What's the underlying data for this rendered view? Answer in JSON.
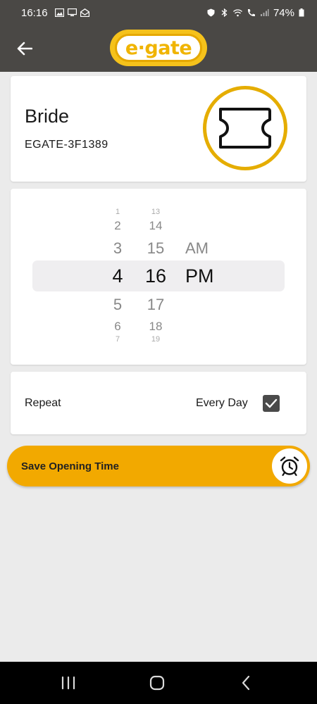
{
  "status_bar": {
    "time": "16:16",
    "battery": "74%"
  },
  "app": {
    "logo_text": "e·gate"
  },
  "device": {
    "name": "Bride",
    "id": "EGATE-3F1389"
  },
  "time_picker": {
    "hours": [
      "1",
      "2",
      "3",
      "4",
      "5",
      "6",
      "7"
    ],
    "minutes": [
      "13",
      "14",
      "15",
      "16",
      "17",
      "18",
      "19"
    ],
    "ampm": [
      "AM",
      "PM"
    ],
    "selected_hour": "4",
    "selected_minute": "16",
    "selected_ampm": "PM"
  },
  "repeat": {
    "label": "Repeat",
    "value": "Every Day",
    "checked": true
  },
  "save_button": {
    "label": "Save Opening Time"
  },
  "colors": {
    "accent": "#f2a900",
    "header": "#4a4845",
    "ring": "#e5ad00"
  },
  "icons": [
    "back-arrow-icon",
    "ticket-icon",
    "checkbox-check-icon",
    "alarm-clock-icon",
    "recents-icon",
    "home-icon",
    "nav-back-icon"
  ]
}
